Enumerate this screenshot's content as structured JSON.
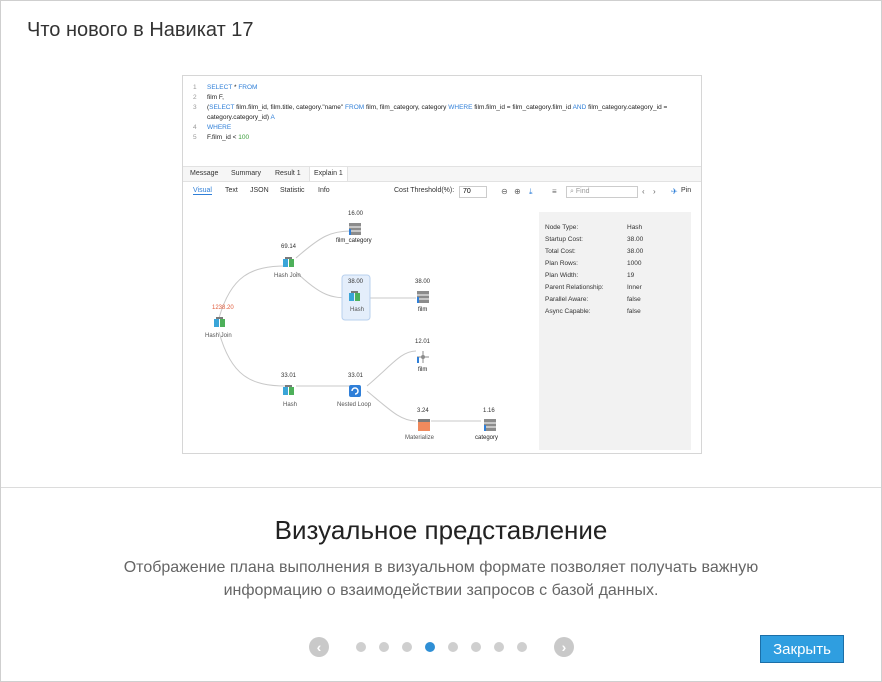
{
  "dialog": {
    "title": "Что нового в Навикат 17",
    "heading": "Визуальное представление",
    "description_line1": "Отображение плана выполнения в визуальном формате позволяет получать важную",
    "description_line2": "информацию о взаимодействии запросов с базой данных.",
    "close_label": "Закрыть",
    "prev_icon": "chevron-left-icon",
    "next_icon": "chevron-right-icon",
    "pager": {
      "count": 8,
      "active_index": 3
    },
    "accent_color": "#2f9ee0"
  },
  "screenshot": {
    "code": {
      "line1_num": "1",
      "line1_kw": "SELECT",
      "line1_rest": " * ",
      "line1_kw2": "FROM",
      "line2_num": "2",
      "line2": "film F,",
      "line3_num": "3",
      "line3_a": "(",
      "line3_kw": "SELECT",
      "line3_b": " film.film_id, film.title, category.\"name\" ",
      "line3_kw2": "FROM",
      "line3_c": " film, film_category, category ",
      "line3_kw3": "WHERE",
      "line3_d": " film.film_id = film_category.film_id ",
      "line3_kw4": "AND",
      "line3_e": " film_category.category_id =",
      "line3_cont": "category.category_id) ",
      "line3_cont_kw": "A",
      "line4_num": "4",
      "line4_kw": "WHERE",
      "line5_num": "5",
      "line5_a": "F.film_id < ",
      "line5_num_val": "100"
    },
    "tabs": [
      "Message",
      "Summary",
      "Result 1",
      "Explain 1"
    ],
    "subtabs": [
      "Visual",
      "Text",
      "JSON",
      "Statistic",
      "Info"
    ],
    "cost_threshold_label": "Cost Threshold(%):",
    "cost_threshold_value": "70",
    "find_placeholder": "Find",
    "pin_label": "Pin",
    "nodes": {
      "root": {
        "cost": "1238.20",
        "label": "Hash Join"
      },
      "hashjoin2": {
        "cost": "69.14",
        "label": "Hash Join"
      },
      "film_category": {
        "cost": "16.00",
        "label": "film_category"
      },
      "hash_sel": {
        "cost": "38.00",
        "label": "Hash"
      },
      "film1": {
        "cost": "38.00",
        "label": "film"
      },
      "hash2": {
        "cost": "33.01",
        "label": "Hash"
      },
      "nested": {
        "cost": "33.01",
        "label": "Nested Loop"
      },
      "film2": {
        "cost": "12.01",
        "label": "film"
      },
      "materialize": {
        "cost": "3.24",
        "label": "Materialize"
      },
      "category": {
        "cost": "1.16",
        "label": "category"
      }
    },
    "details": [
      {
        "k": "Node Type:",
        "v": "Hash"
      },
      {
        "k": "Startup Cost:",
        "v": "38.00"
      },
      {
        "k": "Total Cost:",
        "v": "38.00"
      },
      {
        "k": "Plan Rows:",
        "v": "1000"
      },
      {
        "k": "Plan Width:",
        "v": "19"
      },
      {
        "k": "Parent Relationship:",
        "v": "Inner"
      },
      {
        "k": "Parallel Aware:",
        "v": "false"
      },
      {
        "k": "Async Capable:",
        "v": "false"
      }
    ]
  }
}
